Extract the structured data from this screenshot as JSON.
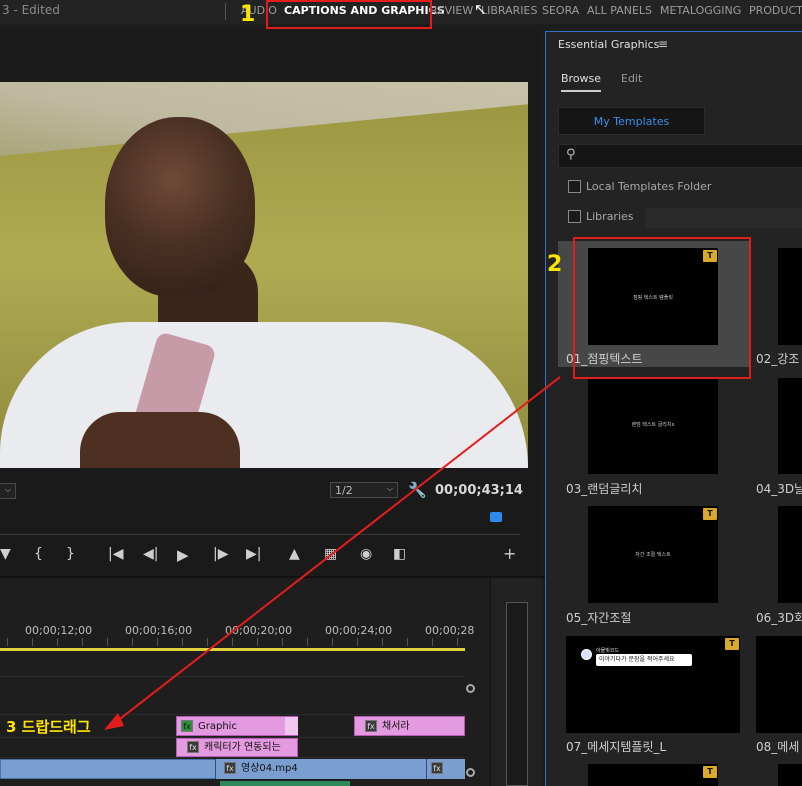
{
  "topbar": {
    "title_suffix": "3 - Edited",
    "workspaces": [
      "AUDIO",
      "CAPTIONS AND GRAPHICS",
      "REVIEW",
      "LIBRARIES",
      "SEORA",
      "ALL PANELS",
      "METALOGGING",
      "PRODUCTI"
    ],
    "active_workspace": "CAPTIONS AND GRAPHICS"
  },
  "annotations": {
    "step1": "1",
    "step2": "2",
    "step3": "3 드랍드래그",
    "highlight_color": "#e51c1c",
    "label_color": "#ffe400"
  },
  "monitor": {
    "zoom_value": "",
    "resolution": "1/2",
    "timecode": "00;00;43;14"
  },
  "transport": {
    "icons": [
      "marker-icon",
      "mark-in-icon",
      "mark-out-icon",
      "go-to-in-icon",
      "step-back-icon",
      "play-icon",
      "step-forward-icon",
      "go-to-out-icon",
      "lift-icon",
      "extract-icon",
      "export-frame-icon",
      "compare-icon",
      "add-button-icon"
    ]
  },
  "timeline": {
    "time_labels": [
      "00;00;12;00",
      "00;00;16;00",
      "00;00;20;00",
      "00;00;24;00",
      "00;00;28"
    ],
    "clips": {
      "graphic": "Graphic",
      "chaeseora": "채서라",
      "character_text": "캐릭터가 연동되는",
      "video": "영상04.mp4"
    }
  },
  "essential_graphics": {
    "title": "Essential Graphics",
    "tabs": [
      "Browse",
      "Edit"
    ],
    "active_tab": "Browse",
    "my_templates": "My Templates",
    "search_placeholder": "",
    "checkboxes": [
      "Local Templates Folder",
      "Libraries"
    ],
    "templates": [
      {
        "name": "01_점핑텍스트",
        "preview": "점핑 텍스트 템플릿"
      },
      {
        "name": "02_강조",
        "preview": ""
      },
      {
        "name": "03_랜덤글리치",
        "preview": "랜덤 텍스트 글리치x"
      },
      {
        "name": "04_3D날",
        "preview": ""
      },
      {
        "name": "05_자간조절",
        "preview": "자간 조절 텍스트"
      },
      {
        "name": "06_3D회",
        "preview": ""
      },
      {
        "name": "07_메세지템플릿_L",
        "preview": "이야기다가 문장을 적어주세요"
      },
      {
        "name": "08_메세",
        "preview": ""
      }
    ],
    "chat_sender": "아물빛코드",
    "badge_glyph": "T"
  }
}
